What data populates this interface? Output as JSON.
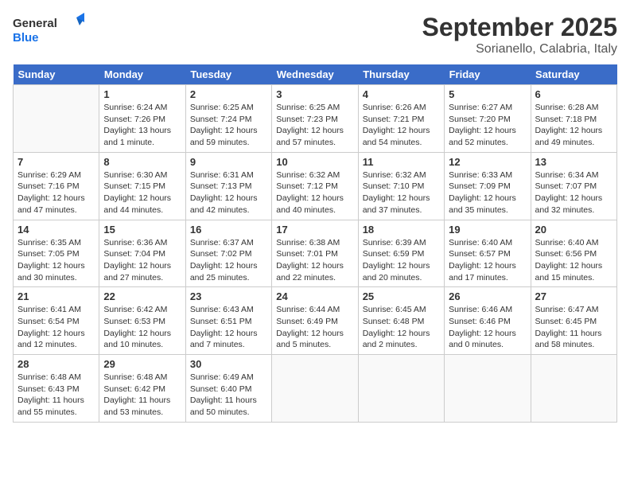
{
  "header": {
    "logo_general": "General",
    "logo_blue": "Blue",
    "month": "September 2025",
    "location": "Sorianello, Calabria, Italy"
  },
  "days_of_week": [
    "Sunday",
    "Monday",
    "Tuesday",
    "Wednesday",
    "Thursday",
    "Friday",
    "Saturday"
  ],
  "weeks": [
    [
      {
        "day": "",
        "info": ""
      },
      {
        "day": "1",
        "info": "Sunrise: 6:24 AM\nSunset: 7:26 PM\nDaylight: 13 hours\nand 1 minute."
      },
      {
        "day": "2",
        "info": "Sunrise: 6:25 AM\nSunset: 7:24 PM\nDaylight: 12 hours\nand 59 minutes."
      },
      {
        "day": "3",
        "info": "Sunrise: 6:25 AM\nSunset: 7:23 PM\nDaylight: 12 hours\nand 57 minutes."
      },
      {
        "day": "4",
        "info": "Sunrise: 6:26 AM\nSunset: 7:21 PM\nDaylight: 12 hours\nand 54 minutes."
      },
      {
        "day": "5",
        "info": "Sunrise: 6:27 AM\nSunset: 7:20 PM\nDaylight: 12 hours\nand 52 minutes."
      },
      {
        "day": "6",
        "info": "Sunrise: 6:28 AM\nSunset: 7:18 PM\nDaylight: 12 hours\nand 49 minutes."
      }
    ],
    [
      {
        "day": "7",
        "info": "Sunrise: 6:29 AM\nSunset: 7:16 PM\nDaylight: 12 hours\nand 47 minutes."
      },
      {
        "day": "8",
        "info": "Sunrise: 6:30 AM\nSunset: 7:15 PM\nDaylight: 12 hours\nand 44 minutes."
      },
      {
        "day": "9",
        "info": "Sunrise: 6:31 AM\nSunset: 7:13 PM\nDaylight: 12 hours\nand 42 minutes."
      },
      {
        "day": "10",
        "info": "Sunrise: 6:32 AM\nSunset: 7:12 PM\nDaylight: 12 hours\nand 40 minutes."
      },
      {
        "day": "11",
        "info": "Sunrise: 6:32 AM\nSunset: 7:10 PM\nDaylight: 12 hours\nand 37 minutes."
      },
      {
        "day": "12",
        "info": "Sunrise: 6:33 AM\nSunset: 7:09 PM\nDaylight: 12 hours\nand 35 minutes."
      },
      {
        "day": "13",
        "info": "Sunrise: 6:34 AM\nSunset: 7:07 PM\nDaylight: 12 hours\nand 32 minutes."
      }
    ],
    [
      {
        "day": "14",
        "info": "Sunrise: 6:35 AM\nSunset: 7:05 PM\nDaylight: 12 hours\nand 30 minutes."
      },
      {
        "day": "15",
        "info": "Sunrise: 6:36 AM\nSunset: 7:04 PM\nDaylight: 12 hours\nand 27 minutes."
      },
      {
        "day": "16",
        "info": "Sunrise: 6:37 AM\nSunset: 7:02 PM\nDaylight: 12 hours\nand 25 minutes."
      },
      {
        "day": "17",
        "info": "Sunrise: 6:38 AM\nSunset: 7:01 PM\nDaylight: 12 hours\nand 22 minutes."
      },
      {
        "day": "18",
        "info": "Sunrise: 6:39 AM\nSunset: 6:59 PM\nDaylight: 12 hours\nand 20 minutes."
      },
      {
        "day": "19",
        "info": "Sunrise: 6:40 AM\nSunset: 6:57 PM\nDaylight: 12 hours\nand 17 minutes."
      },
      {
        "day": "20",
        "info": "Sunrise: 6:40 AM\nSunset: 6:56 PM\nDaylight: 12 hours\nand 15 minutes."
      }
    ],
    [
      {
        "day": "21",
        "info": "Sunrise: 6:41 AM\nSunset: 6:54 PM\nDaylight: 12 hours\nand 12 minutes."
      },
      {
        "day": "22",
        "info": "Sunrise: 6:42 AM\nSunset: 6:53 PM\nDaylight: 12 hours\nand 10 minutes."
      },
      {
        "day": "23",
        "info": "Sunrise: 6:43 AM\nSunset: 6:51 PM\nDaylight: 12 hours\nand 7 minutes."
      },
      {
        "day": "24",
        "info": "Sunrise: 6:44 AM\nSunset: 6:49 PM\nDaylight: 12 hours\nand 5 minutes."
      },
      {
        "day": "25",
        "info": "Sunrise: 6:45 AM\nSunset: 6:48 PM\nDaylight: 12 hours\nand 2 minutes."
      },
      {
        "day": "26",
        "info": "Sunrise: 6:46 AM\nSunset: 6:46 PM\nDaylight: 12 hours\nand 0 minutes."
      },
      {
        "day": "27",
        "info": "Sunrise: 6:47 AM\nSunset: 6:45 PM\nDaylight: 11 hours\nand 58 minutes."
      }
    ],
    [
      {
        "day": "28",
        "info": "Sunrise: 6:48 AM\nSunset: 6:43 PM\nDaylight: 11 hours\nand 55 minutes."
      },
      {
        "day": "29",
        "info": "Sunrise: 6:48 AM\nSunset: 6:42 PM\nDaylight: 11 hours\nand 53 minutes."
      },
      {
        "day": "30",
        "info": "Sunrise: 6:49 AM\nSunset: 6:40 PM\nDaylight: 11 hours\nand 50 minutes."
      },
      {
        "day": "",
        "info": ""
      },
      {
        "day": "",
        "info": ""
      },
      {
        "day": "",
        "info": ""
      },
      {
        "day": "",
        "info": ""
      }
    ]
  ]
}
